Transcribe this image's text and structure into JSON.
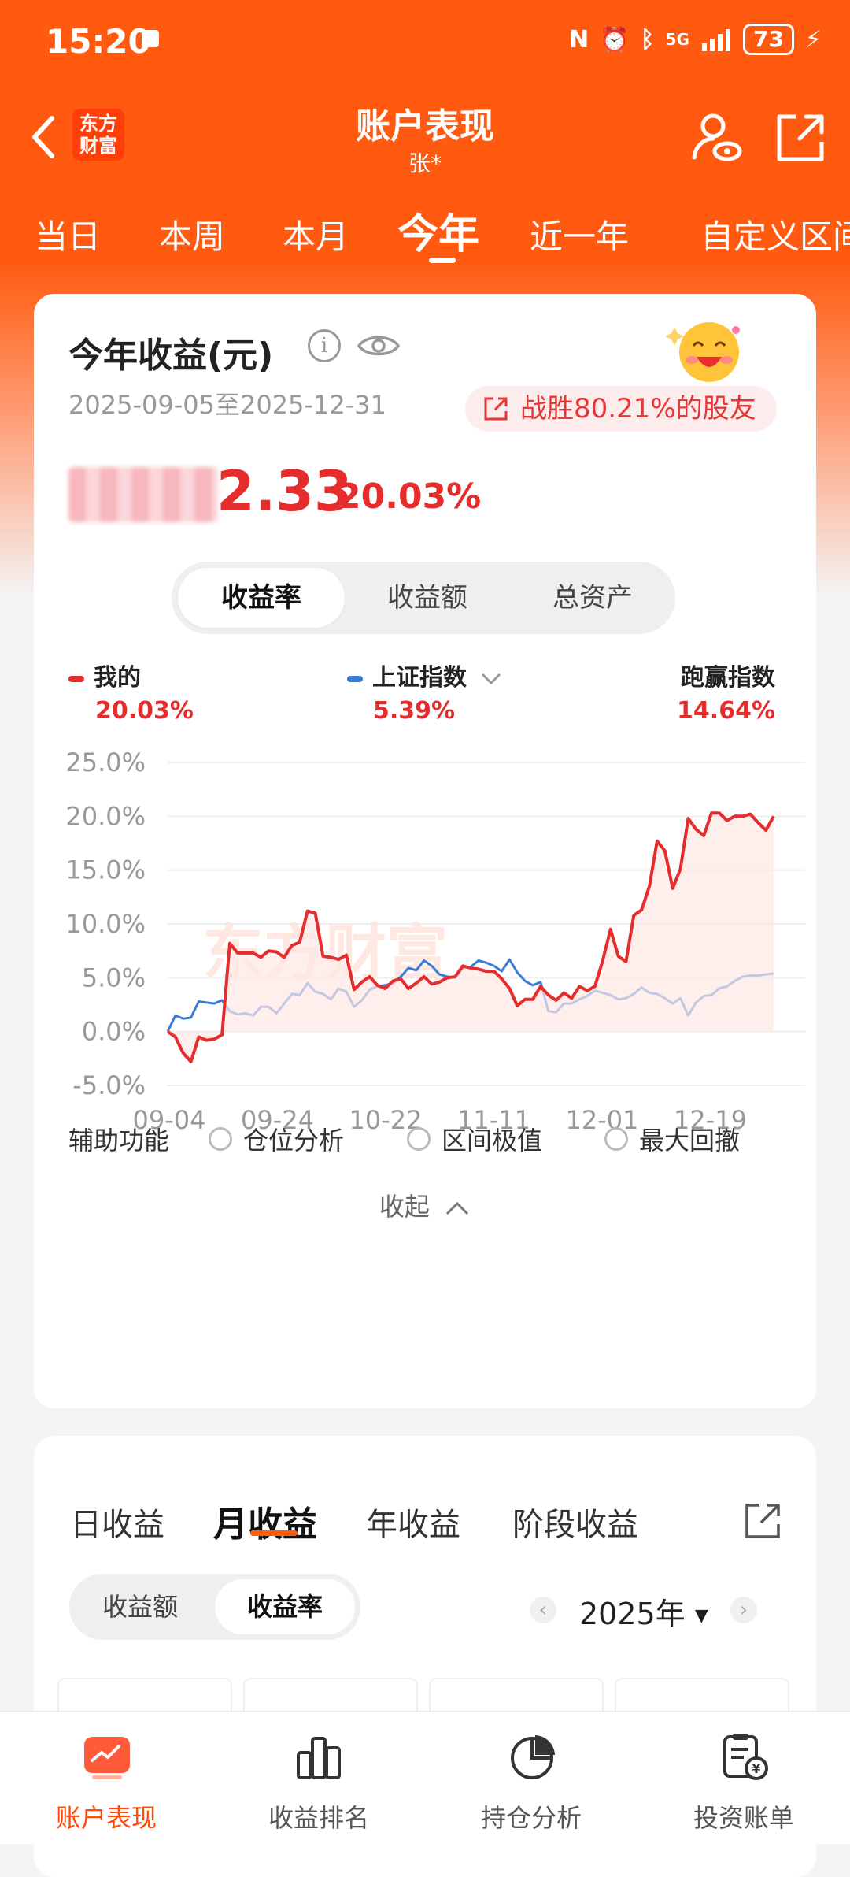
{
  "status_bar": {
    "time": "15:20",
    "network": "5G",
    "battery": "73"
  },
  "header": {
    "back_icon": "chevron-left",
    "logo_text": "东方财富",
    "title": "账户表现",
    "subtitle": "张*"
  },
  "tabs": [
    "当日",
    "本周",
    "本月",
    "今年",
    "近一年",
    "自定义区间"
  ],
  "active_tab": "今年",
  "summary": {
    "title": "今年收益(元)",
    "date_range": "2025-09-05至2025-12-31",
    "beat_text": "战胜80.21%的股友",
    "amount_tail": "2.33",
    "return_pct": "20.03%"
  },
  "segment": {
    "options": [
      "收益率",
      "收益额",
      "总资产"
    ],
    "selected": "收益率"
  },
  "legend": {
    "mine_label": "我的",
    "mine_value": "20.03%",
    "index_label": "上证指数",
    "index_value": "5.39%",
    "beat_label": "跑赢指数",
    "beat_value": "14.64%"
  },
  "watermark": "东方财富",
  "colors": {
    "brand": "#ff5a0f",
    "mine": "#e62d2d",
    "index": "#3a7bd5"
  },
  "chart_data": {
    "type": "line",
    "yticks": [
      "25.0%",
      "20.0%",
      "15.0%",
      "10.0%",
      "5.0%",
      "0.0%",
      "-5.0%"
    ],
    "ylim": [
      -5,
      25
    ],
    "xticks": [
      "09-04",
      "09-24",
      "10-22",
      "11-11",
      "12-01",
      "12-19"
    ],
    "series": [
      {
        "name": "我的",
        "color": "#e62d2d",
        "values": [
          0,
          -0.5,
          -2,
          -2.8,
          -0.5,
          -0.8,
          -0.7,
          -0.3,
          8.2,
          7.3,
          7.3,
          7.3,
          6.9,
          7.5,
          7.4,
          6.9,
          8.0,
          8.3,
          11.2,
          11.0,
          7.0,
          6.9,
          6.7,
          7.1,
          3.9,
          4.6,
          5.1,
          4.3,
          4.0,
          4.7,
          4.9,
          4.0,
          4.5,
          5.1,
          4.4,
          4.6,
          5.0,
          5.1,
          6.1,
          5.9,
          5.8,
          5.6,
          5.6,
          4.9,
          4.0,
          2.4,
          3.0,
          3.0,
          4.2,
          3.4,
          2.9,
          3.6,
          3.1,
          4.2,
          3.8,
          4.2,
          6.6,
          9.5,
          7.0,
          6.5,
          10.8,
          11.3,
          13.5,
          17.7,
          16.8,
          13.3,
          15.1,
          19.8,
          18.8,
          18.2,
          20.3,
          20.3,
          19.6,
          20.0,
          20.0,
          20.2,
          19.4,
          18.7,
          20.0
        ]
      },
      {
        "name": "上证指数",
        "color": "#3a7bd5",
        "values": [
          0,
          1.5,
          1.2,
          1.3,
          2.8,
          2.7,
          2.6,
          2.9,
          1.9,
          1.6,
          1.7,
          1.5,
          2.3,
          2.3,
          1.7,
          2.6,
          3.5,
          3.4,
          4.5,
          3.7,
          3.5,
          3.0,
          4.0,
          3.7,
          2.3,
          2.9,
          3.9,
          4.2,
          4.3,
          4.5,
          5.1,
          5.9,
          5.7,
          6.6,
          6.1,
          5.3,
          5.1,
          5.0,
          5.9,
          6.0,
          6.6,
          6.4,
          6.1,
          5.6,
          6.7,
          5.5,
          4.7,
          4.3,
          4.6,
          1.9,
          1.8,
          2.6,
          2.6,
          3.0,
          3.3,
          3.8,
          3.6,
          3.4,
          3.0,
          3.1,
          3.5,
          4.1,
          3.6,
          3.5,
          3.1,
          2.6,
          3.1,
          1.5,
          2.7,
          3.3,
          3.4,
          4.0,
          4.2,
          4.7,
          5.1,
          5.2,
          5.2,
          5.3,
          5.4
        ]
      }
    ]
  },
  "aux": {
    "label": "辅助功能",
    "options": [
      "仓位分析",
      "区间极值",
      "最大回撤"
    ],
    "collapse": "收起"
  },
  "income_tabs": [
    "日收益",
    "月收益",
    "年收益",
    "阶段收益"
  ],
  "income_active": "月收益",
  "income_segment": {
    "options": [
      "收益额",
      "收益率"
    ],
    "selected": "收益率"
  },
  "year": "2025年",
  "bottom_nav": [
    {
      "label": "账户表现",
      "icon": "account-performance-icon",
      "active": true
    },
    {
      "label": "收益排名",
      "icon": "ranking-icon",
      "active": false
    },
    {
      "label": "持仓分析",
      "icon": "pie-chart-icon",
      "active": false
    },
    {
      "label": "投资账单",
      "icon": "bill-icon",
      "active": false
    }
  ]
}
